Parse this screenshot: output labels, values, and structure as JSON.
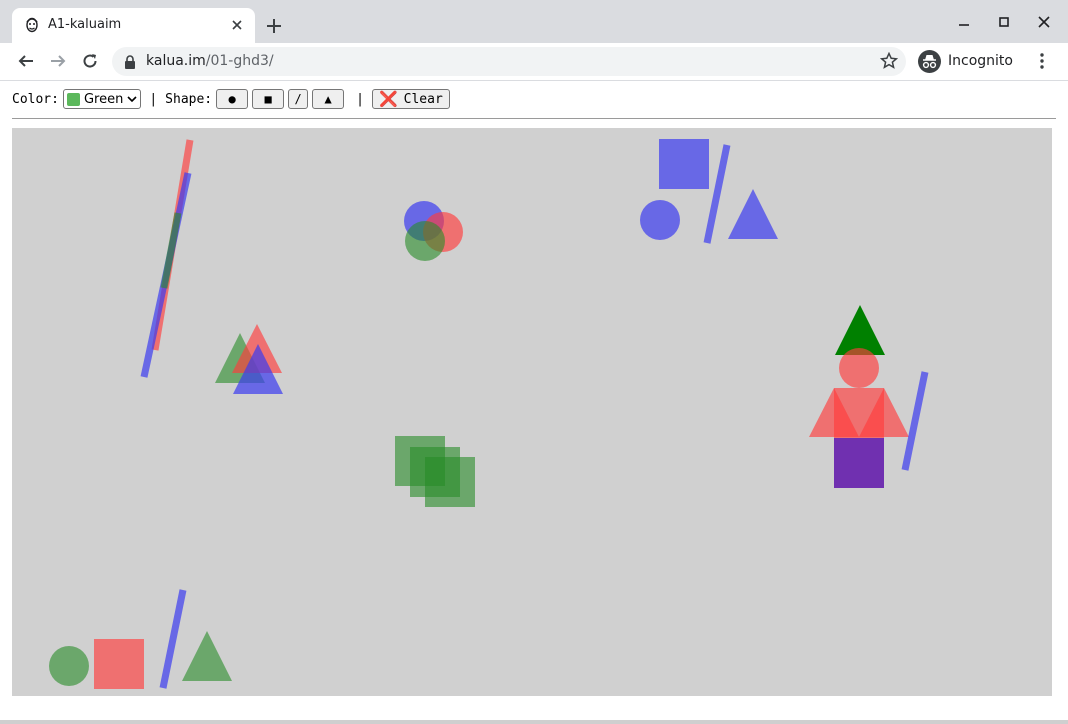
{
  "browser": {
    "tab_title": "A1-kaluaim",
    "url_host": "kalua.im",
    "url_path": "/01-ghd3/",
    "profile_label": "Incognito"
  },
  "controls": {
    "color_label": "Color:",
    "color_selected": "Green",
    "color_swatch": "#5cb85c",
    "separator": "|",
    "shape_label": "Shape:",
    "shapes": [
      "●",
      "■",
      "/",
      "▲"
    ],
    "clear_icon": "❌",
    "clear_label": "Clear"
  },
  "canvas": {
    "background": "#d0d0d0",
    "colors": {
      "red": "rgba(255,60,60,0.65)",
      "green": "rgba(40,140,40,0.6)",
      "blue": "rgba(60,60,240,0.7)",
      "green_solid": "#008000",
      "purple": "#7030b0"
    }
  }
}
